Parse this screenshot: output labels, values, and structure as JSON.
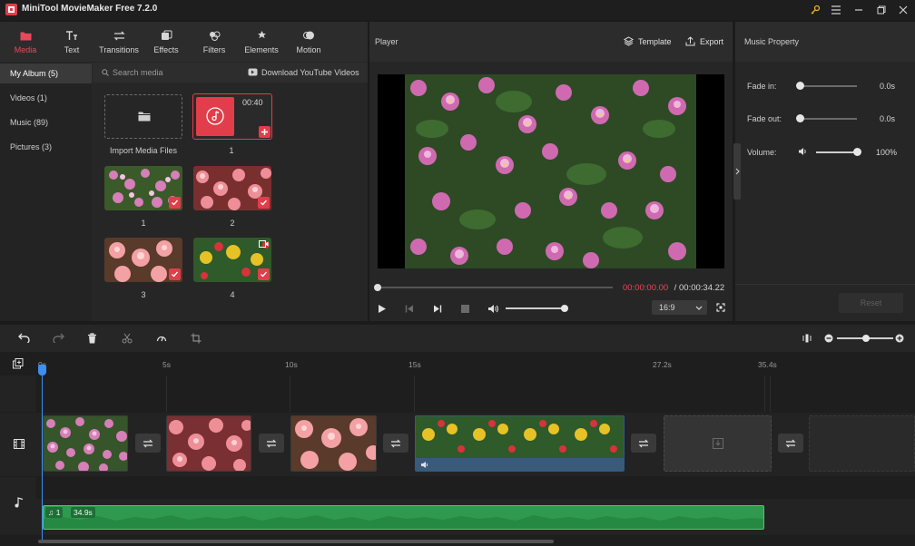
{
  "app": {
    "title": "MiniTool MovieMaker Free 7.2.0"
  },
  "tool_tabs": [
    {
      "label": "Media",
      "icon": "folder-icon",
      "active": true
    },
    {
      "label": "Text",
      "icon": "text-icon"
    },
    {
      "label": "Transitions",
      "icon": "transitions-icon"
    },
    {
      "label": "Effects",
      "icon": "effects-icon"
    },
    {
      "label": "Filters",
      "icon": "filters-icon"
    },
    {
      "label": "Elements",
      "icon": "elements-icon"
    },
    {
      "label": "Motion",
      "icon": "motion-icon"
    }
  ],
  "sidebar": {
    "items": [
      {
        "label": "My Album (5)",
        "active": true
      },
      {
        "label": "Videos (1)"
      },
      {
        "label": "Music (89)"
      },
      {
        "label": "Pictures (3)"
      }
    ]
  },
  "media": {
    "search_placeholder": "Search media",
    "youtube_label": "Download YouTube Videos",
    "import_label": "Import Media Files",
    "music_item": {
      "duration": "00:40",
      "label": "1"
    },
    "items": [
      {
        "label": "1"
      },
      {
        "label": "2"
      },
      {
        "label": "3"
      },
      {
        "label": "4"
      }
    ]
  },
  "player": {
    "title": "Player",
    "template_label": "Template",
    "export_label": "Export",
    "time_current": "00:00:00.00",
    "time_separator": " / ",
    "time_total": "00:00:34.22",
    "progress": 0.0,
    "volume": 1.0,
    "aspect_ratio": "16:9"
  },
  "music_property": {
    "title": "Music Property",
    "fade_in_label": "Fade in:",
    "fade_in_value": "0.0s",
    "fade_out_label": "Fade out:",
    "fade_out_value": "0.0s",
    "volume_label": "Volume:",
    "volume_value": "100%",
    "reset_label": "Reset"
  },
  "timeline": {
    "ruler": [
      "0s",
      "5s",
      "10s",
      "15s",
      "27.2s",
      "35.4s"
    ],
    "audio_clip": {
      "index": "1",
      "duration": "34.9s"
    }
  },
  "colors": {
    "accent": "#e23d4a",
    "playhead": "#3f8ef2",
    "audio_clip": "#2f9a4f"
  }
}
